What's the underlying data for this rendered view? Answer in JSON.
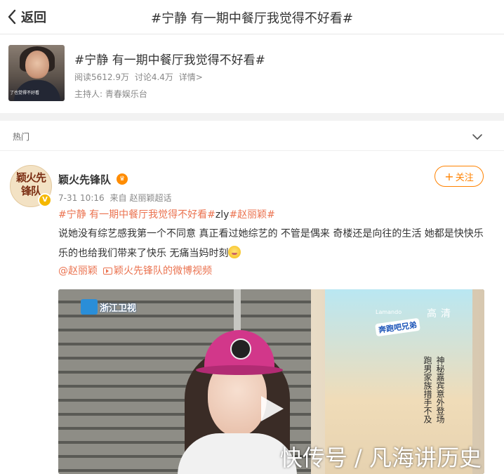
{
  "header": {
    "back_label": "返回",
    "title": "#宁静 有一期中餐厅我觉得不好看#"
  },
  "topic": {
    "title": "#宁静 有一期中餐厅我觉得不好看#",
    "read_count": "阅读5612.9万",
    "discussion_count": "讨论4.4万",
    "details_link": "详情>",
    "host_label": "主持人:",
    "host_name": "青春娱乐台",
    "thumb_caption": "了也觉得不好看"
  },
  "feed": {
    "section_label": "热门"
  },
  "post": {
    "avatar_text": "颖火先锋队",
    "avatar_badge": "V",
    "username": "颖火先锋队",
    "timestamp": "7-31 10:16",
    "source_prefix": "来自",
    "source_name": "赵丽颖超话",
    "follow_label": "关注",
    "hashtag_1": "#宁静 有一期中餐厅我觉得不好看#",
    "plain_tag": "zly",
    "hashtag_2": "#赵丽颖#",
    "body": "说她没有综艺感我第一个不同意 真正看过她综艺的 不管是偶来 奇楼还是向往的生活 她都是快快乐乐的也给我们带来了快乐 无痛当妈时刻",
    "mention": "@赵丽颖",
    "video_link": "颖火先锋队的微博视频"
  },
  "video": {
    "tv_logo": "浙江卫视",
    "hd_label": "高清",
    "show_brand": "Lamando",
    "show_logo": "奔跑吧兄弟",
    "board_text": "神秘嘉宾意外登场",
    "board_text_2": "跑男家族措手不及",
    "watermark": "快传号 / 凡海讲历史"
  },
  "colors": {
    "accent_orange": "#ff8200",
    "link_color": "#eb7350",
    "background": "#f2f2f2"
  }
}
